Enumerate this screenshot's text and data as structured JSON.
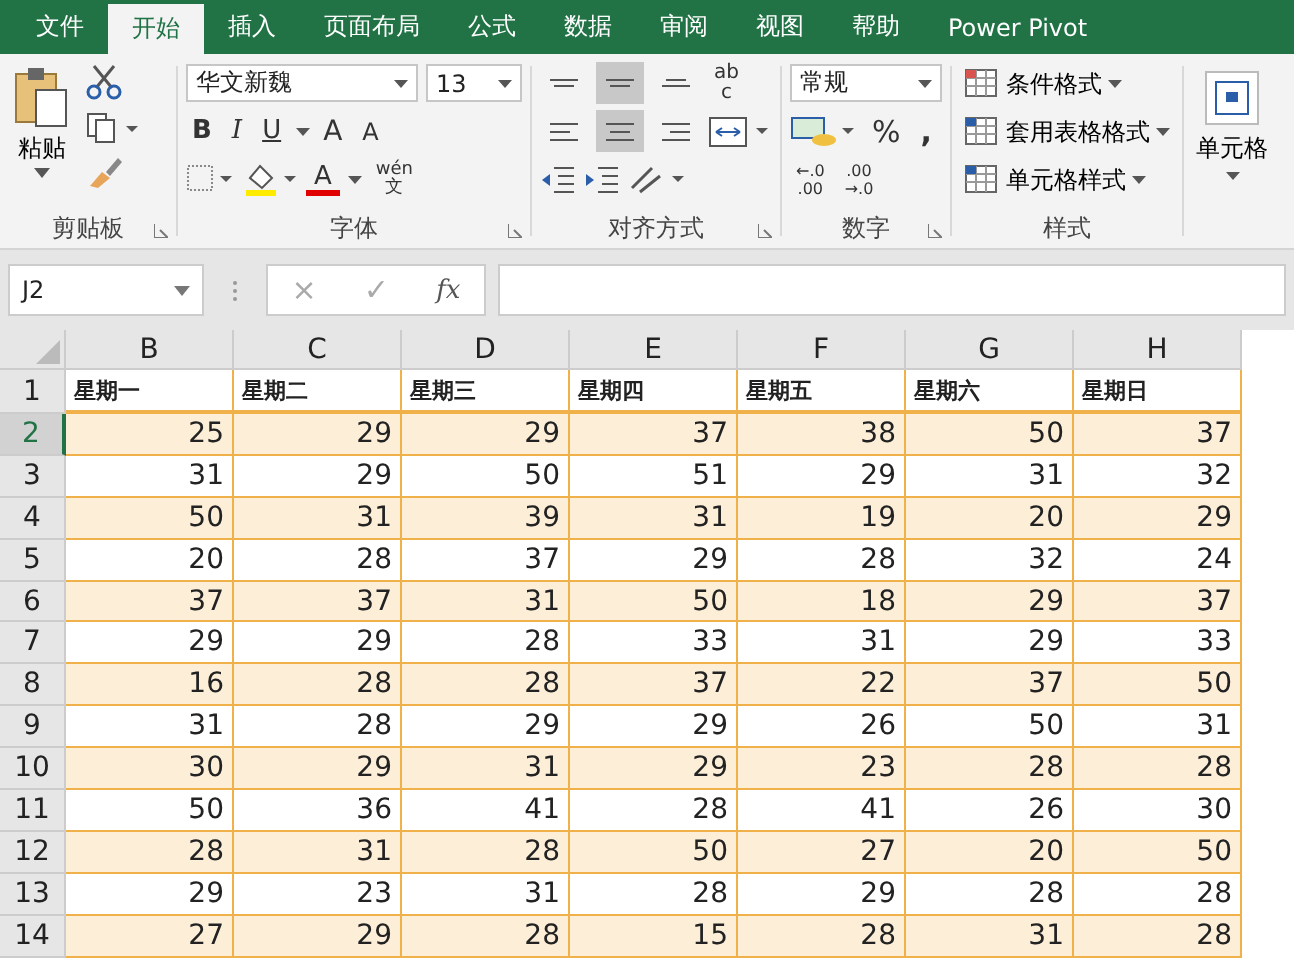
{
  "tabs": [
    {
      "label": "文件",
      "selected": false
    },
    {
      "label": "开始",
      "selected": true
    },
    {
      "label": "插入",
      "selected": false
    },
    {
      "label": "页面布局",
      "selected": false
    },
    {
      "label": "公式",
      "selected": false
    },
    {
      "label": "数据",
      "selected": false
    },
    {
      "label": "审阅",
      "selected": false
    },
    {
      "label": "视图",
      "selected": false
    },
    {
      "label": "帮助",
      "selected": false
    },
    {
      "label": "Power Pivot",
      "selected": false
    }
  ],
  "ribbon": {
    "clipboard": {
      "paste_label": "粘贴",
      "group_label": "剪贴板"
    },
    "font": {
      "font_name": "华文新魏",
      "font_size": "13",
      "bold": "B",
      "italic": "I",
      "underline": "U",
      "grow": "A",
      "shrink": "A",
      "font_color": "A",
      "phonetic_top": "wén",
      "phonetic_bottom": "文",
      "group_label": "字体"
    },
    "alignment": {
      "top_align_selected": false,
      "middle_align_selected": true,
      "bottom_align_selected": false,
      "left_selected": false,
      "center_selected": true,
      "right_selected": false,
      "wrap_top": "ab",
      "wrap_bottom": "c",
      "group_label": "对齐方式"
    },
    "number": {
      "format": "常规",
      "percent": "%",
      "comma": ",",
      "inc_top": "←.0",
      "inc_bottom": ".00",
      "dec_top": ".00",
      "dec_bottom": "→.0",
      "group_label": "数字"
    },
    "styles": {
      "items": [
        "条件格式",
        "套用表格格式",
        "单元格样式"
      ],
      "group_label": "样式"
    },
    "cells": {
      "label": "单元格"
    }
  },
  "name_box": "J2",
  "formula_icons": {
    "cancel": "×",
    "enter": "✓",
    "function": "fx"
  },
  "columns": [
    "B",
    "C",
    "D",
    "E",
    "F",
    "G",
    "H"
  ],
  "header_row": {
    "number": "1",
    "cells": [
      "星期一",
      "星期二",
      "星期三",
      "星期四",
      "星期五",
      "星期六",
      "星期日"
    ]
  },
  "rows": [
    {
      "number": "2",
      "selected": true,
      "shaded": true,
      "cells": [
        "25",
        "29",
        "29",
        "37",
        "38",
        "50",
        "37"
      ]
    },
    {
      "number": "3",
      "selected": false,
      "shaded": false,
      "cells": [
        "31",
        "29",
        "50",
        "51",
        "29",
        "31",
        "32"
      ]
    },
    {
      "number": "4",
      "selected": false,
      "shaded": true,
      "cells": [
        "50",
        "31",
        "39",
        "31",
        "19",
        "20",
        "29"
      ]
    },
    {
      "number": "5",
      "selected": false,
      "shaded": false,
      "cells": [
        "20",
        "28",
        "37",
        "29",
        "28",
        "32",
        "24"
      ]
    },
    {
      "number": "6",
      "selected": false,
      "shaded": true,
      "cells": [
        "37",
        "37",
        "31",
        "50",
        "18",
        "29",
        "37"
      ]
    },
    {
      "number": "7",
      "selected": false,
      "shaded": false,
      "cells": [
        "29",
        "29",
        "28",
        "33",
        "31",
        "29",
        "33"
      ]
    },
    {
      "number": "8",
      "selected": false,
      "shaded": true,
      "cells": [
        "16",
        "28",
        "28",
        "37",
        "22",
        "37",
        "50"
      ]
    },
    {
      "number": "9",
      "selected": false,
      "shaded": false,
      "cells": [
        "31",
        "28",
        "29",
        "29",
        "26",
        "50",
        "31"
      ]
    },
    {
      "number": "10",
      "selected": false,
      "shaded": true,
      "cells": [
        "30",
        "29",
        "31",
        "29",
        "23",
        "28",
        "28"
      ]
    },
    {
      "number": "11",
      "selected": false,
      "shaded": false,
      "cells": [
        "50",
        "36",
        "41",
        "28",
        "41",
        "26",
        "30"
      ]
    },
    {
      "number": "12",
      "selected": false,
      "shaded": true,
      "cells": [
        "28",
        "31",
        "28",
        "50",
        "27",
        "20",
        "50"
      ]
    },
    {
      "number": "13",
      "selected": false,
      "shaded": false,
      "cells": [
        "29",
        "23",
        "31",
        "28",
        "29",
        "28",
        "28"
      ]
    },
    {
      "number": "14",
      "selected": false,
      "shaded": true,
      "cells": [
        "27",
        "29",
        "28",
        "15",
        "28",
        "31",
        "28"
      ]
    }
  ]
}
